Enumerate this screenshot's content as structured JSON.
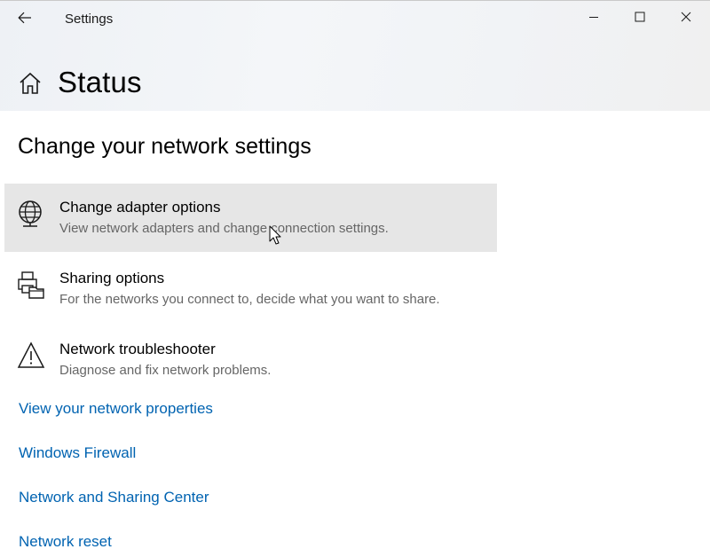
{
  "window": {
    "title": "Settings"
  },
  "page": {
    "title": "Status"
  },
  "section": {
    "title": "Change your network settings"
  },
  "options": [
    {
      "title": "Change adapter options",
      "description": "View network adapters and change connection settings.",
      "icon": "globe-adapter-icon",
      "state": "hover"
    },
    {
      "title": "Sharing options",
      "description": "For the networks you connect to, decide what you want to share.",
      "icon": "sharing-printer-icon"
    },
    {
      "title": "Network troubleshooter",
      "description": "Diagnose and fix network problems.",
      "icon": "warning-icon"
    }
  ],
  "links": [
    {
      "label": "View your network properties"
    },
    {
      "label": "Windows Firewall"
    },
    {
      "label": "Network and Sharing Center"
    },
    {
      "label": "Network reset"
    }
  ],
  "colors": {
    "link": "#0063b1",
    "hover_bg": "#e6e6e6",
    "secondary_text": "#666666"
  }
}
